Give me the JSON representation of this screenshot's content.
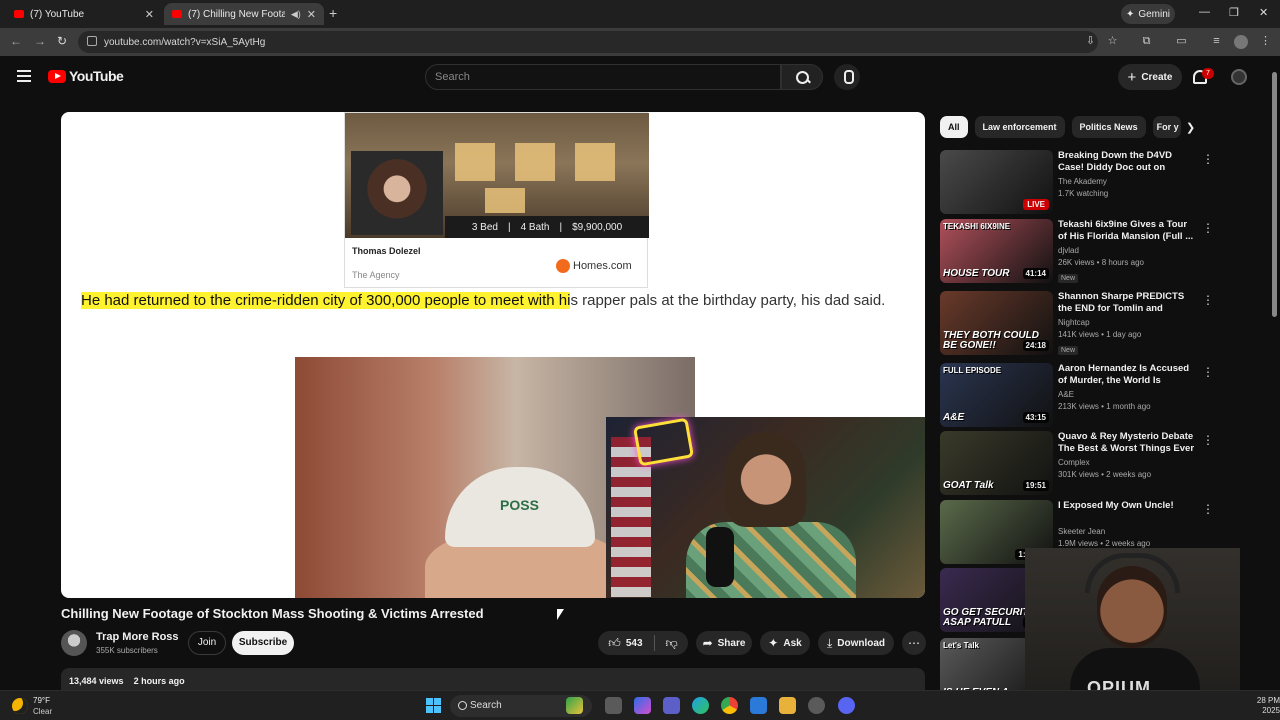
{
  "browser": {
    "tabs": [
      {
        "title": "(7) YouTube",
        "active": false
      },
      {
        "title": "(7) Chilling New Footage of",
        "active": true
      }
    ],
    "gemini_label": "Gemini",
    "url": "youtube.com/watch?v=xSiA_5AytHg"
  },
  "youtube": {
    "logo_text": "YouTube",
    "search_placeholder": "Search",
    "create_label": "Create",
    "notification_count": "7"
  },
  "player": {
    "house_card": {
      "beds": "3 Bed",
      "baths": "4 Bath",
      "price": "$9,900,000",
      "agent_name": "Thomas Dolezel",
      "agency": "The Agency",
      "brand": "Homes.com"
    },
    "article": {
      "highlighted": "He had returned to the crime-ridden city of 300,000 people to meet with hi",
      "rest": "s rapper pals at the birthday party, his dad said."
    },
    "cap_text": "POSS"
  },
  "video": {
    "title": "Chilling New Footage of Stockton Mass Shooting & Victims Arrested",
    "channel": "Trap More Ross",
    "subscribers": "355K subscribers",
    "join_label": "Join",
    "subscribe_label": "Subscribe",
    "likes": "543",
    "share_label": "Share",
    "ask_label": "Ask",
    "download_label": "Download",
    "views": "13,484 views",
    "age": "2 hours ago"
  },
  "chips": [
    "All",
    "Law enforcement",
    "Politics News",
    "For y"
  ],
  "recommendations": [
    {
      "title": "Breaking Down the D4VD Case! Diddy Doc out on Netflix. ...",
      "channel": "The Akademy",
      "meta": "1.7K watching",
      "badge": "",
      "duration": "",
      "live_label": "LIVE",
      "overlay": "",
      "overlay_top": "",
      "thumb": "#4a4a4a"
    },
    {
      "title": "Tekashi 6ix9ine Gives a Tour of His Florida Mansion (Full ...",
      "channel": "djvlad",
      "meta": "26K views • 8 hours ago",
      "badge": "New",
      "duration": "41:14",
      "live_label": "",
      "overlay": "HOUSE TOUR",
      "overlay_top": "TEKASHI 6IX9INE",
      "thumb": "#b0505a"
    },
    {
      "title": "Shannon Sharpe PREDICTS the END for Tomlin and Rodgers ...",
      "channel": "Nightcap",
      "meta": "141K views • 1 day ago",
      "badge": "New",
      "duration": "24:18",
      "live_label": "",
      "overlay": "THEY BOTH COULD BE GONE!!",
      "overlay_top": "",
      "thumb": "#6a3a2a"
    },
    {
      "title": "Aaron Hernandez Is Accused of Murder, the World Is Watching ...",
      "channel": "A&E",
      "meta": "213K views • 1 month ago",
      "badge": "",
      "duration": "43:15",
      "live_label": "",
      "overlay": "A&E",
      "overlay_top": "FULL EPISODE",
      "thumb": "#2a3550"
    },
    {
      "title": "Quavo & Rey Mysterio Debate The Best & Worst Things Ever | ...",
      "channel": "Complex",
      "meta": "301K views • 2 weeks ago",
      "badge": "",
      "duration": "19:51",
      "live_label": "",
      "overlay": "GOAT Talk",
      "overlay_top": "",
      "thumb": "#3a3a2a"
    },
    {
      "title": "I Exposed My Own Uncle!",
      "channel": "Skeeter Jean",
      "meta": "1.9M views • 2 weeks ago",
      "badge": "",
      "duration": "1:16:39",
      "live_label": "",
      "overlay": "",
      "overlay_top": "",
      "thumb": "#5a6a4a"
    },
    {
      "title": "Shannon S... Eagles' ...",
      "channel": "Nightcap",
      "meta": "",
      "badge": "",
      "duration": "19:40",
      "live_label": "",
      "overlay": "GO GET SECURITY ASAP PATULL",
      "overlay_top": "",
      "thumb": "#3a2a50"
    },
    {
      "title": "",
      "channel": "",
      "meta": "",
      "badge": "",
      "duration": "",
      "live_label": "",
      "overlay": "IS HE EVEN A",
      "overlay_top": "Let's Talk",
      "thumb": "#5a5a5a"
    }
  ],
  "webcam": {
    "shirt_text": "OPIUM"
  },
  "taskbar": {
    "temperature": "79°F",
    "weather": "Clear",
    "search_label": "Search",
    "time": "28 PM",
    "date": "2025"
  }
}
